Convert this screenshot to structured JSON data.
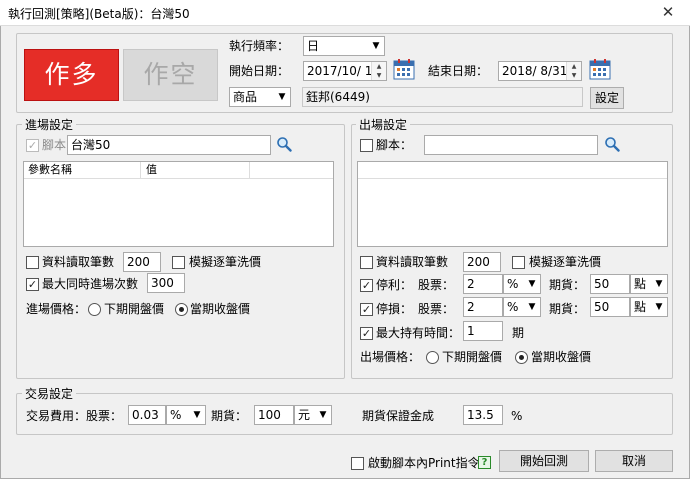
{
  "window": {
    "title": "執行回測[策略](Beta版)：台灣50"
  },
  "direction": {
    "long_label": "作多",
    "short_label": "作空"
  },
  "top": {
    "freq_label": "執行頻率：",
    "freq_value": "日",
    "start_label": "開始日期：",
    "start_value": "2017/10/  1",
    "end_label": "結束日期：",
    "end_value": "2018/  8/31",
    "product_type": "商品",
    "product_value": "鈺邦(6449)",
    "set_button": "設定"
  },
  "entry": {
    "legend": "進場設定",
    "script_label": "腳本",
    "script_value": "台灣50",
    "col_param": "參數名稱",
    "col_value": "值",
    "bars_label": "資料讀取筆數",
    "bars_value": "200",
    "tick_label": "模擬逐筆洗價",
    "max_label": "最大同時進場次數",
    "max_value": "300",
    "price_label": "進場價格：",
    "opt_next_open": "下期開盤價",
    "opt_close": "當期收盤價"
  },
  "exit": {
    "legend": "出場設定",
    "script_label": "腳本：",
    "script_value": "",
    "bars_label": "資料讀取筆數",
    "bars_value": "200",
    "tick_label": "模擬逐筆洗價",
    "profit_label": "停利：",
    "profit_stock_label": "股票：",
    "profit_stock_value": "2",
    "profit_stock_unit": "%",
    "profit_fut_label": "期貨：",
    "profit_fut_value": "50",
    "profit_fut_unit": "點",
    "loss_label": "停損：",
    "loss_stock_label": "股票：",
    "loss_stock_value": "2",
    "loss_stock_unit": "%",
    "loss_fut_label": "期貨：",
    "loss_fut_value": "50",
    "loss_fut_unit": "點",
    "hold_label": "最大持有時間：",
    "hold_value": "1",
    "hold_unit": "期",
    "price_label": "出場價格：",
    "opt_next_open": "下期開盤價",
    "opt_close": "當期收盤價"
  },
  "trade": {
    "legend": "交易設定",
    "fee_label": "交易費用：股票：",
    "fee_stock_value": "0.03",
    "fee_stock_unit": "%",
    "fee_fut_label": "期貨：",
    "fee_fut_value": "100",
    "fee_fut_unit": "元",
    "margin_label": "期貨保證金成",
    "margin_value": "13.5",
    "margin_unit": "%"
  },
  "footer": {
    "print_label": "啟動腳本內Print指令",
    "help_glyph": "?",
    "start_button": "開始回測",
    "cancel_button": "取消"
  },
  "icons": {
    "close": "close-icon",
    "calendar": "calendar-icon",
    "search": "search-icon",
    "dropdown": "chevron-down-icon",
    "help": "help-icon"
  },
  "colors": {
    "long": "#e52d27",
    "short_disabled": "#d9d9d9"
  }
}
